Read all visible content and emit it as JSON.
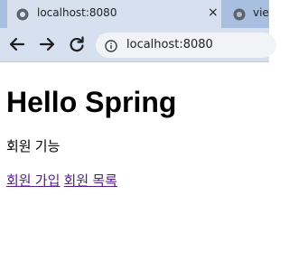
{
  "browser": {
    "active_tab": {
      "title": "localhost:8080",
      "icon": "globe-icon",
      "close": "×"
    },
    "inactive_tab": {
      "title": "vie",
      "icon": "globe-icon"
    },
    "toolbar": {
      "back_icon": "back-arrow-icon",
      "forward_icon": "forward-arrow-icon",
      "reload_icon": "reload-icon",
      "url": "localhost:8080",
      "info_icon": "info-icon"
    }
  },
  "page": {
    "heading": "Hello Spring",
    "section_title": "회원 기능",
    "links": {
      "join": "회원 가입",
      "list": "회원 목록"
    }
  }
}
